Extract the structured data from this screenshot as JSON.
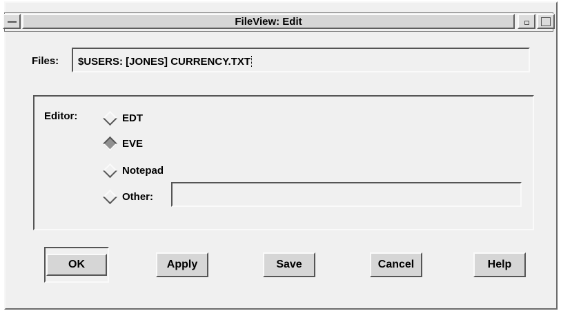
{
  "window": {
    "title": "FileView: Edit"
  },
  "files": {
    "label": "Files:",
    "value": "$USERS: [JONES] CURRENCY.TXT"
  },
  "editor": {
    "label": "Editor:",
    "options": [
      {
        "label": "EDT",
        "selected": false
      },
      {
        "label": "EVE",
        "selected": true
      },
      {
        "label": "Notepad",
        "selected": false
      },
      {
        "label": "Other:",
        "selected": false
      }
    ],
    "other_value": ""
  },
  "buttons": {
    "ok": "OK",
    "apply": "Apply",
    "save": "Save",
    "cancel": "Cancel",
    "help": "Help"
  },
  "colors": {
    "background": "#f0f0f0",
    "bevel_light": "#fafafa",
    "bevel_dark": "#555555",
    "selected_radio": "#909090"
  }
}
